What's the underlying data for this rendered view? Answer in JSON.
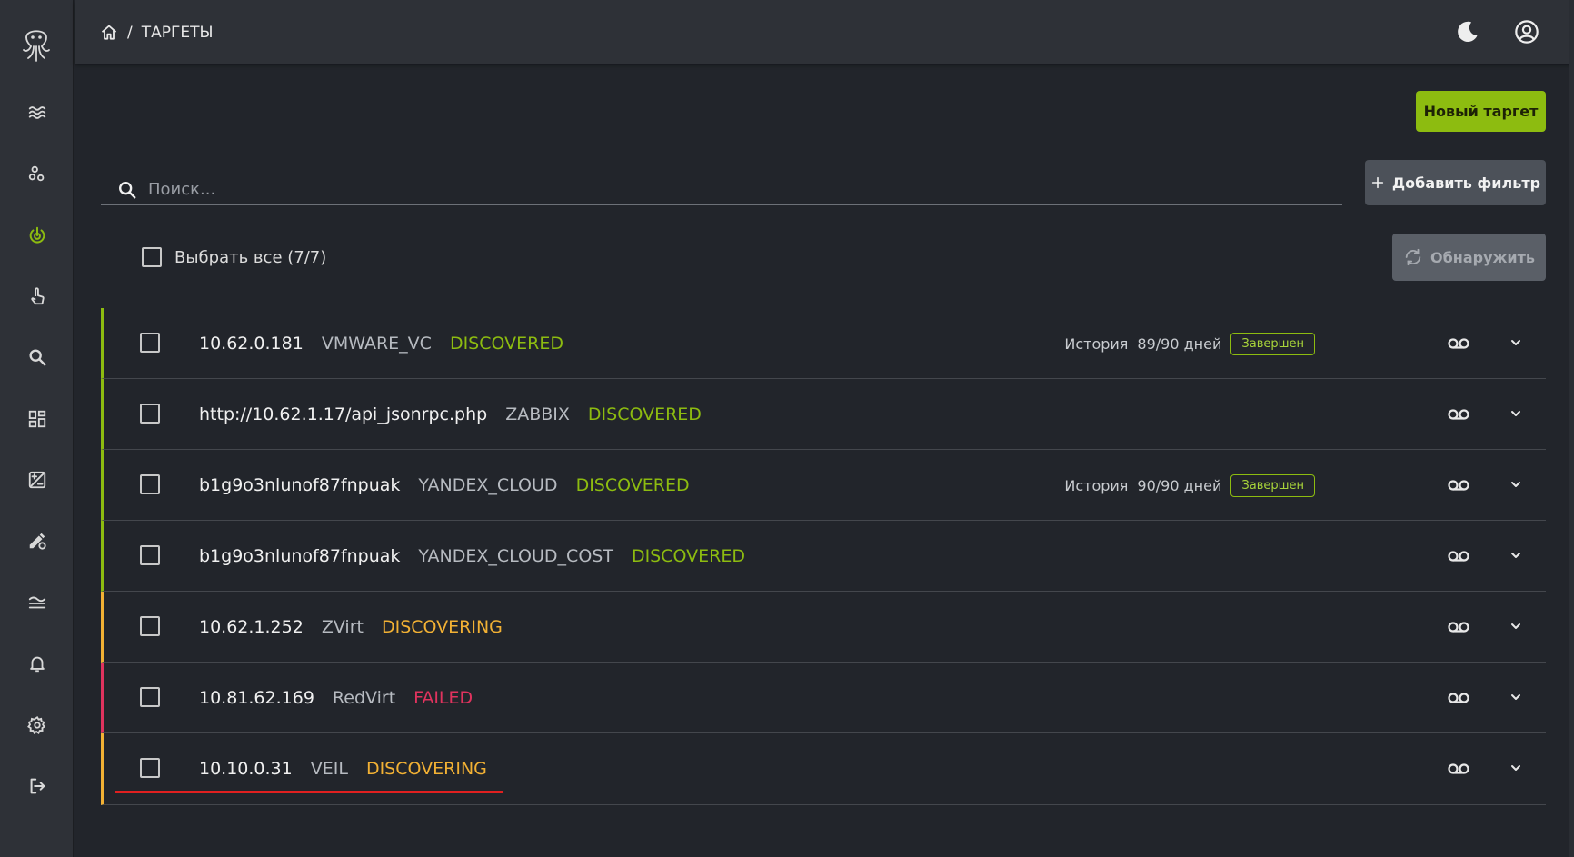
{
  "header": {
    "breadcrumb_sep": "/",
    "title": "ТАРГЕТЫ"
  },
  "toolbar": {
    "new_target_label": "Новый таргет",
    "add_filter_label": "Добавить фильтр",
    "discover_label": "Обнаружить"
  },
  "search": {
    "placeholder": "Поиск..."
  },
  "select_all": {
    "label": "Выбрать все (7/7)"
  },
  "colors": {
    "discovered": "#8dbc10",
    "discovering": "#f2b134",
    "failed": "#e0335e"
  },
  "targets": [
    {
      "name": "10.62.0.181",
      "type": "VMWARE_VC",
      "status": "DISCOVERED",
      "history_label": "История",
      "history_value": "89/90 дней",
      "badge": "Завершен"
    },
    {
      "name": "http://10.62.1.17/api_jsonrpc.php",
      "type": "ZABBIX",
      "status": "DISCOVERED"
    },
    {
      "name": "b1g9o3nlunof87fnpuak",
      "type": "YANDEX_CLOUD",
      "status": "DISCOVERED",
      "history_label": "История",
      "history_value": "90/90 дней",
      "badge": "Завершен"
    },
    {
      "name": "b1g9o3nlunof87fnpuak",
      "type": "YANDEX_CLOUD_COST",
      "status": "DISCOVERED"
    },
    {
      "name": "10.62.1.252",
      "type": "ZVirt",
      "status": "DISCOVERING"
    },
    {
      "name": "10.81.62.169",
      "type": "RedVirt",
      "status": "FAILED"
    },
    {
      "name": "10.10.0.31",
      "type": "VEIL",
      "status": "DISCOVERING"
    }
  ]
}
